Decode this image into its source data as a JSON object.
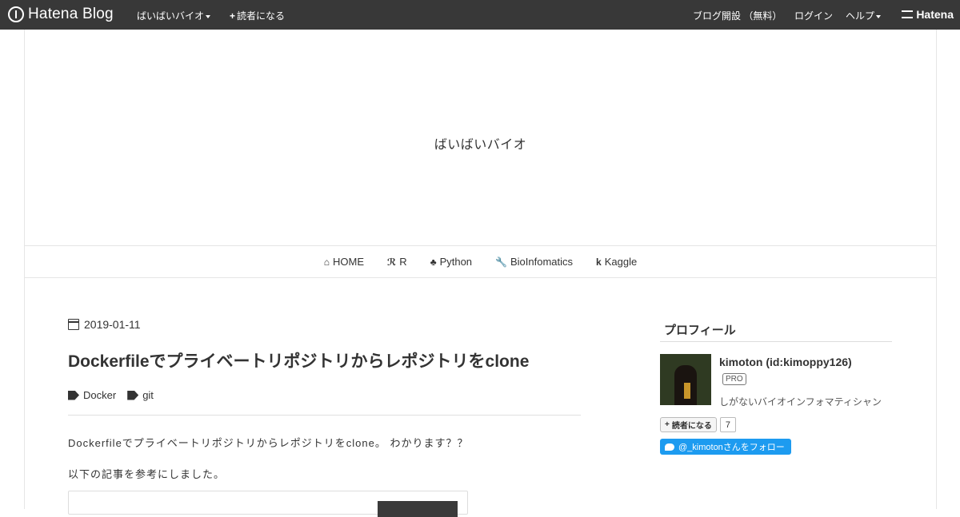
{
  "topbar": {
    "logo_text": "Hatena Blog",
    "blog_menu": "ばいばいバイオ",
    "subscribe": "読者になる",
    "open_blog": "ブログ開設 （無料）",
    "login": "ログイン",
    "help": "ヘルプ",
    "hatena": "Hatena"
  },
  "header": {
    "blog_title": "ばいばいバイオ"
  },
  "nav": {
    "items": [
      {
        "icon": "home-icon",
        "glyph": "⌂",
        "label": "HOME"
      },
      {
        "icon": "r-logo-icon",
        "glyph": "ℛ",
        "label": "R"
      },
      {
        "icon": "python-icon",
        "glyph": "♣",
        "label": "Python"
      },
      {
        "icon": "wrench-icon",
        "glyph": "🔧",
        "label": "BioInfomatics"
      },
      {
        "icon": "kaggle-icon",
        "glyph": "k",
        "label": "Kaggle"
      }
    ]
  },
  "article": {
    "date": "2019-01-11",
    "title": "Dockerfileでプライベートリポジトリからレポジトリをclone",
    "tags": [
      "Docker",
      "git"
    ],
    "paragraph1": "Dockerfileでプライベートリポジトリからレポジトリをclone。 わかります？？",
    "paragraph2": "以下の記事を参考にしました。"
  },
  "sidebar": {
    "heading": "プロフィール",
    "name": "kimoton (id:kimoppy126)",
    "badge": "PRO",
    "description": "しがないバイオインフォマティシャン",
    "subscribe_label": "読者になる",
    "subscriber_count": "7",
    "twitter_label": "@_kimotonさんをフォロー"
  }
}
